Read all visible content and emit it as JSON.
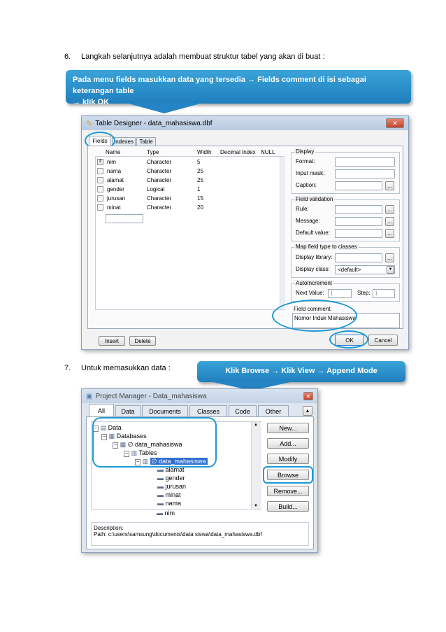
{
  "steps": {
    "six_number": "6.",
    "six_text": "Langkah selanjutnya adalah membuat struktur tabel yang akan di buat :",
    "seven_number": "7.",
    "seven_text": "Untuk memasukkan data :"
  },
  "callouts": {
    "first_line1": "Pada menu fields masukkan data yang tersedia  → Fields comment di isi sebagai keterangan table",
    "first_line2": "→ klik OK",
    "second": "Klik Browse → Klik View → Append Mode"
  },
  "table_designer": {
    "title": "Table Designer - data_mahasiswa.dbf",
    "tabs": [
      "Fields",
      "Indexes",
      "Table"
    ],
    "columns": [
      "Name",
      "Type",
      "Width",
      "Decimal",
      "Index",
      "NULL"
    ],
    "rows": [
      {
        "name": "nim",
        "type": "Character",
        "width": "5"
      },
      {
        "name": "nama",
        "type": "Character",
        "width": "25"
      },
      {
        "name": "alamat",
        "type": "Character",
        "width": "25"
      },
      {
        "name": "gender",
        "type": "Logical",
        "width": "1"
      },
      {
        "name": "jurusan",
        "type": "Character",
        "width": "15"
      },
      {
        "name": "minat",
        "type": "Character",
        "width": "20"
      }
    ],
    "display_group": "Display",
    "format_label": "Format:",
    "input_mask_label": "Input mask:",
    "caption_label": "Caption:",
    "field_validation_group": "Field validation",
    "rule_label": "Rule:",
    "message_label": "Message:",
    "default_value_label": "Default value:",
    "map_group": "Map field type to classes",
    "display_library_label": "Display library:",
    "display_class_label": "Display class:",
    "display_class_value": "<default>",
    "autoincrement_group": "AutoIncrement",
    "next_value_label": "Next Value:",
    "next_value": "1",
    "step_label": "Step:",
    "step_value": "1",
    "field_comment_label": "Field comment:",
    "field_comment_value": "Nomor Induk Mahasiswa",
    "ellipsis": "...",
    "insert_button": "Insert",
    "delete_button": "Delete",
    "ok_button": "OK",
    "cancel_button": "Cancel"
  },
  "project_manager": {
    "title": "Project Manager - Data_mahasiswa",
    "tabs": [
      "All",
      "Data",
      "Documents",
      "Classes",
      "Code",
      "Other"
    ],
    "tree": {
      "data": "Data",
      "databases": "Databases",
      "db_name": "∅ data_mahasiswa",
      "tables": "Tables",
      "table_name": "∅ data_mahasiswa",
      "fields": [
        "alamat",
        "gender",
        "jurusan",
        "minat",
        "nama",
        "nim"
      ]
    },
    "buttons": [
      "New...",
      "Add...",
      "Modify",
      "Browse",
      "Remove...",
      "Build..."
    ],
    "description_label": "Description:",
    "path": "Path: c:\\users\\samsung\\documents\\data siswa\\data_mahasiswa.dbf"
  },
  "colors": {
    "callout": "#2a8fcb",
    "ring": "#1c9ad6",
    "selection": "#2f6fd0"
  }
}
